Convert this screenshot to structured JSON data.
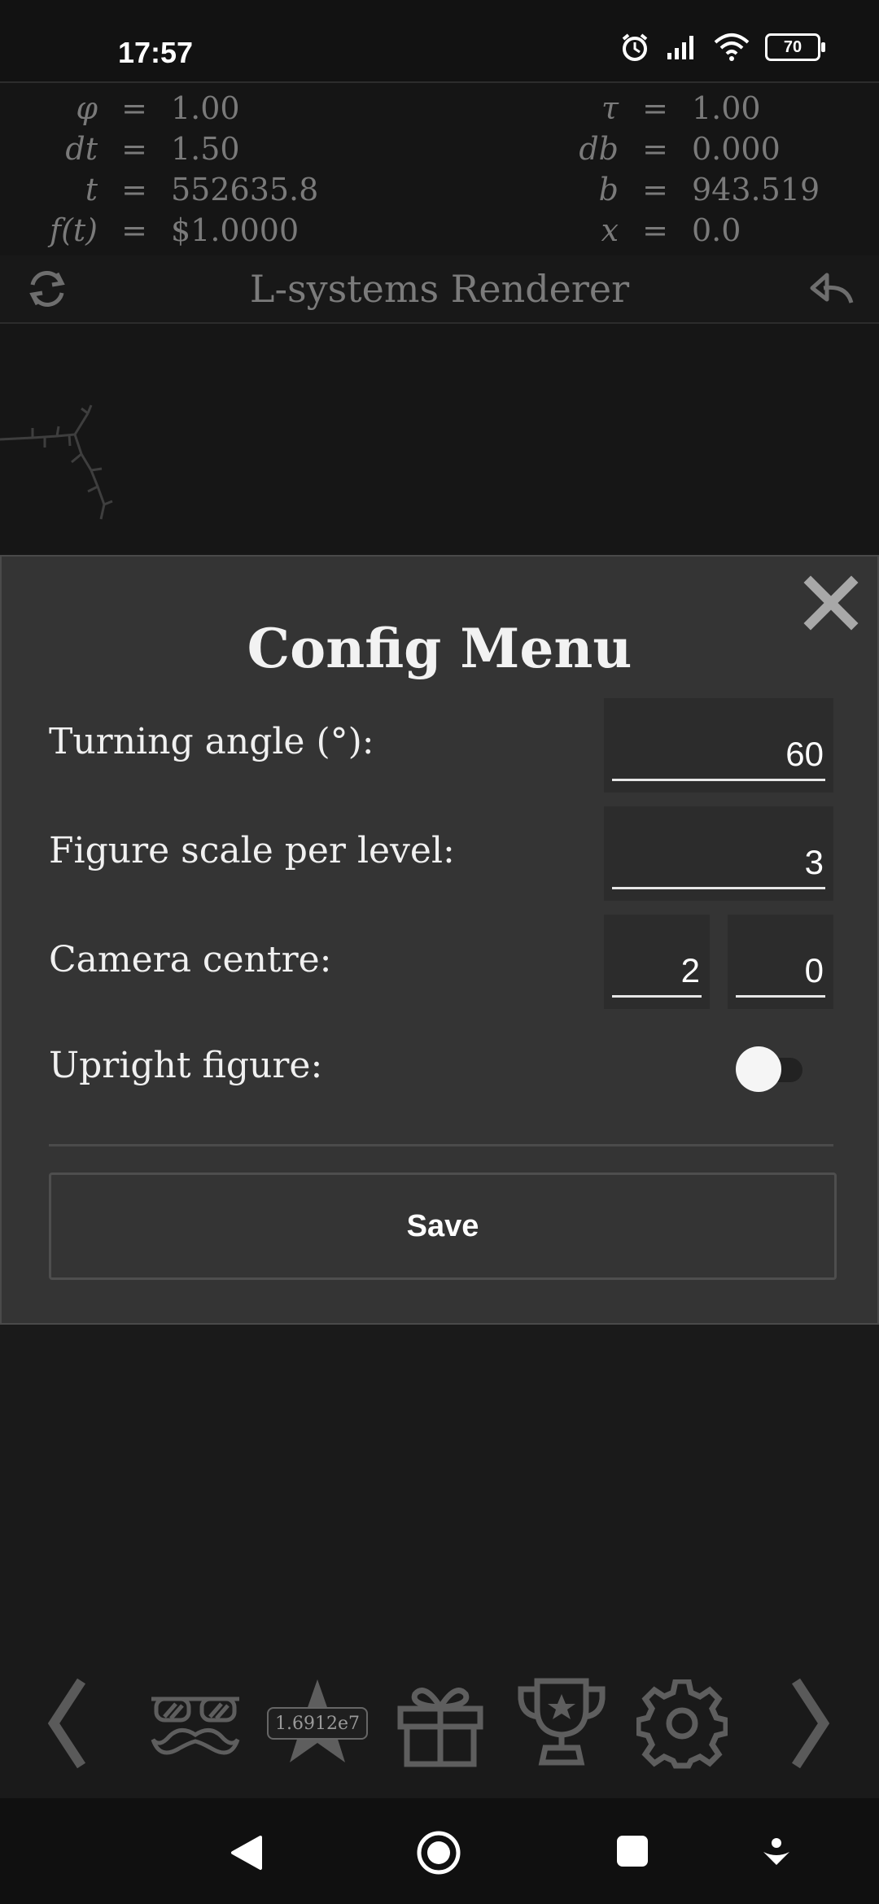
{
  "status_bar": {
    "time": "17:57",
    "battery": "70"
  },
  "equations": {
    "left": [
      {
        "symbol": "φ",
        "equals": "=",
        "value": "1.00"
      },
      {
        "symbol": "dt",
        "equals": "=",
        "value": "1.50"
      },
      {
        "symbol": "t",
        "equals": "=",
        "value": "552635.8"
      },
      {
        "symbol": "f(t)",
        "equals": "=",
        "value": "$1.0000"
      }
    ],
    "right": [
      {
        "symbol": "τ",
        "equals": "=",
        "value": "1.00"
      },
      {
        "symbol": "db",
        "equals": "=",
        "value": "0.000"
      },
      {
        "symbol": "b",
        "equals": "=",
        "value": "943.519"
      },
      {
        "symbol": "x",
        "equals": "=",
        "value": "0.0"
      }
    ]
  },
  "header": {
    "title": "L-systems Renderer"
  },
  "config_menu": {
    "title": "Config Menu",
    "turning_angle": {
      "label": "Turning angle (°):",
      "value": "60"
    },
    "figure_scale": {
      "label": "Figure scale per level:",
      "value": "3"
    },
    "camera_centre": {
      "label": "Camera centre:",
      "x": "2",
      "y": "0"
    },
    "upright_figure": {
      "label": "Upright figure:",
      "on": false
    },
    "save_label": "Save"
  },
  "toolbar": {
    "badge": "1.6912e7"
  },
  "colors": {
    "background": "#1a1a1a",
    "modal": "#343434",
    "muted_text": "#7a7a7a"
  },
  "icons": {
    "toolbar": [
      "chevron-left-icon",
      "glasses-mustache-icon",
      "star-icon",
      "gift-icon",
      "trophy-icon",
      "gear-icon",
      "chevron-right-icon"
    ],
    "nav": [
      "back-icon",
      "home-icon",
      "recents-icon",
      "assist-icon"
    ]
  }
}
